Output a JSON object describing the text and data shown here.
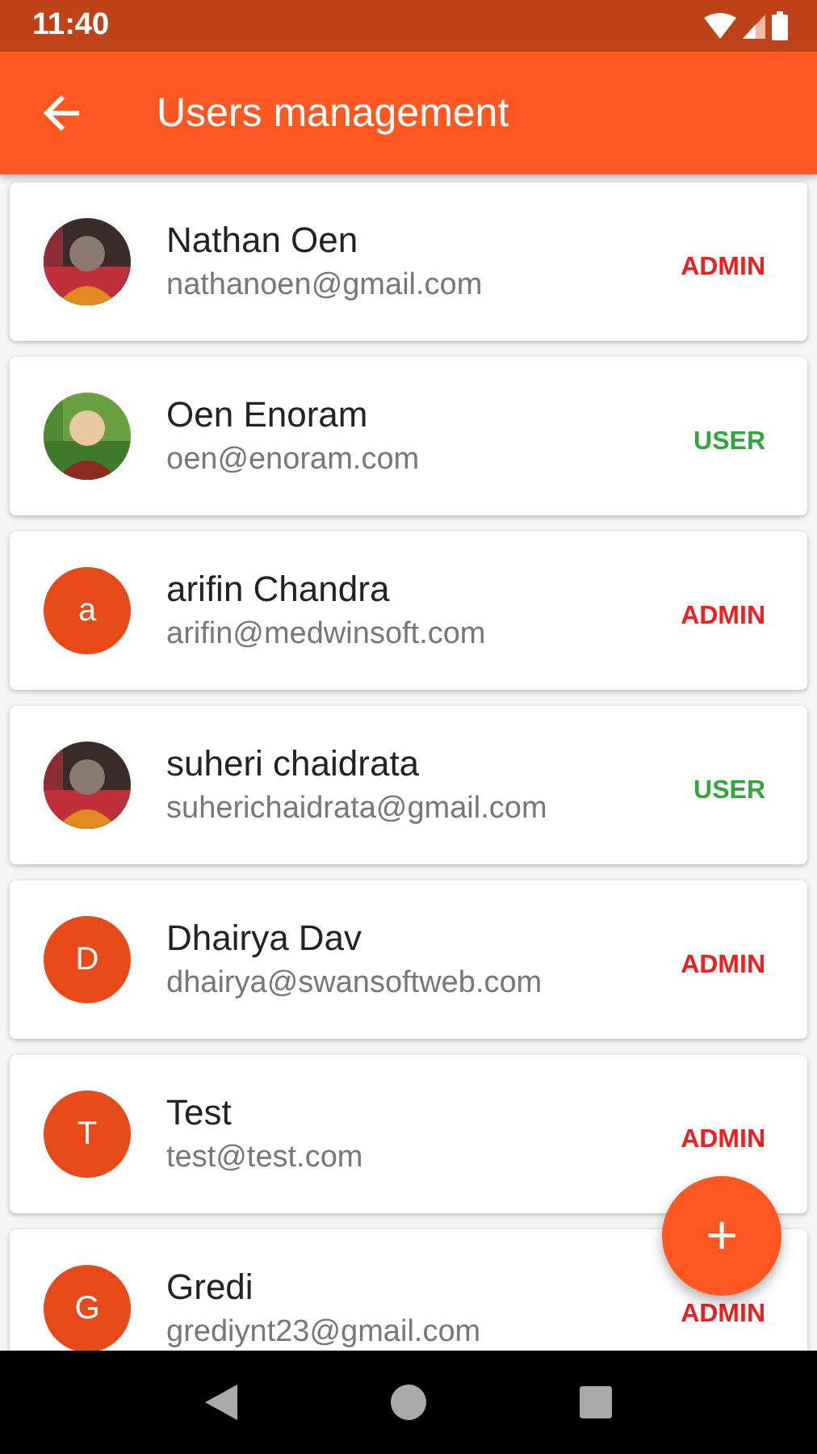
{
  "status_bar": {
    "time": "11:40"
  },
  "app_bar": {
    "title": "Users management"
  },
  "users": [
    {
      "name": "Nathan Oen",
      "email": "nathanoen@gmail.com",
      "role": {
        "text": "ADMIN",
        "color": "#f01e1e"
      }
    },
    {
      "name": "Oen Enoram",
      "email": "oen@enoram.com",
      "role": {
        "text": "USER",
        "color": "#2ea83a"
      }
    },
    {
      "name": "arifin Chandra",
      "email": "arifin@medwinsoft.com",
      "avatar": {
        "kind": "letter",
        "letter": "a"
      },
      "role": {
        "text": "ADMIN",
        "color": "#f01e1e"
      }
    },
    {
      "name": "suheri chaidrata",
      "email": "suherichaidrata@gmail.com",
      "role": {
        "text": "USER",
        "color": "#2ea83a"
      }
    },
    {
      "name": "Dhairya Dav",
      "email": "dhairya@swansoftweb.com",
      "avatar": {
        "kind": "letter",
        "letter": "D"
      },
      "role": {
        "text": "ADMIN",
        "color": "#f01e1e"
      }
    },
    {
      "name": "Test",
      "email": "test@test.com",
      "avatar": {
        "kind": "letter",
        "letter": "T"
      },
      "role": {
        "text": "ADMIN",
        "color": "#f01e1e"
      }
    },
    {
      "name": "Gredi",
      "email": "grediynt23@gmail.com",
      "avatar": {
        "kind": "letter",
        "letter": "G"
      },
      "role": {
        "text": "ADMIN",
        "color": "#f01e1e"
      }
    }
  ],
  "fab": {
    "label": "+"
  }
}
